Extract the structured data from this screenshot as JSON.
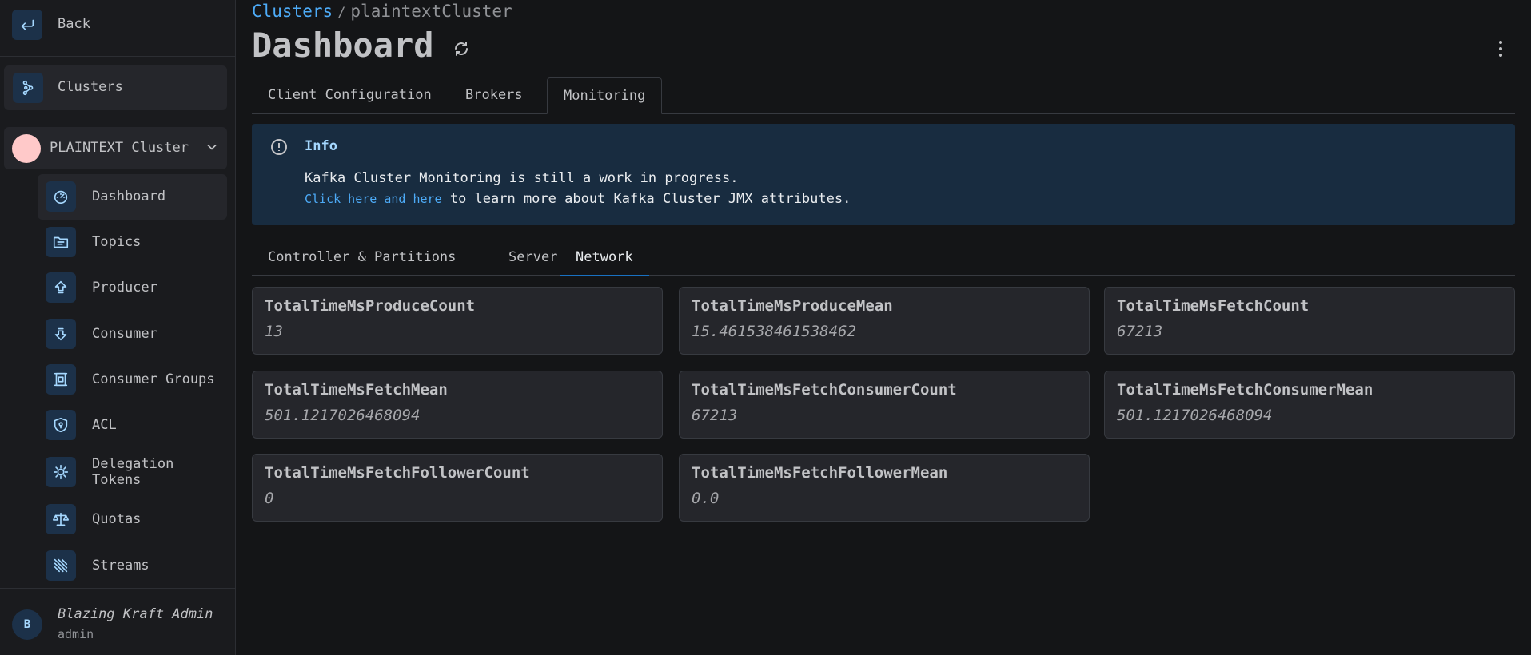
{
  "sidebar": {
    "back_label": "Back",
    "clusters_label": "Clusters",
    "cluster_name": "PLAINTEXT Cluster",
    "items": [
      {
        "label": "Dashboard"
      },
      {
        "label": "Topics"
      },
      {
        "label": "Producer"
      },
      {
        "label": "Consumer"
      },
      {
        "label": "Consumer Groups"
      },
      {
        "label": "ACL"
      },
      {
        "label": "Delegation",
        "label2": "Tokens"
      },
      {
        "label": "Quotas"
      },
      {
        "label": "Streams"
      }
    ],
    "user": {
      "initial": "B",
      "name": "Blazing Kraft Admin",
      "role": "admin"
    }
  },
  "breadcrumb": {
    "root": "Clusters",
    "separator": "/",
    "current": "plaintextCluster"
  },
  "page_title": "Dashboard",
  "tabs": [
    "Client Configuration",
    "Brokers",
    "Monitoring"
  ],
  "info": {
    "title": "Info",
    "line1": "Kafka Cluster Monitoring is still a work in progress.",
    "link": "Click here and here",
    "line2_rest": " to learn more about Kafka Cluster JMX attributes."
  },
  "sub_tabs": [
    "Controller & Partitions",
    "Server",
    "Network"
  ],
  "metrics": [
    {
      "name": "TotalTimeMsProduceCount",
      "value": "13"
    },
    {
      "name": "TotalTimeMsProduceMean",
      "value": "15.461538461538462"
    },
    {
      "name": "TotalTimeMsFetchCount",
      "value": "67213"
    },
    {
      "name": "TotalTimeMsFetchMean",
      "value": "501.1217026468094"
    },
    {
      "name": "TotalTimeMsFetchConsumerCount",
      "value": "67213"
    },
    {
      "name": "TotalTimeMsFetchConsumerMean",
      "value": "501.1217026468094"
    },
    {
      "name": "TotalTimeMsFetchFollowerCount",
      "value": "0"
    },
    {
      "name": "TotalTimeMsFetchFollowerMean",
      "value": "0.0"
    }
  ]
}
